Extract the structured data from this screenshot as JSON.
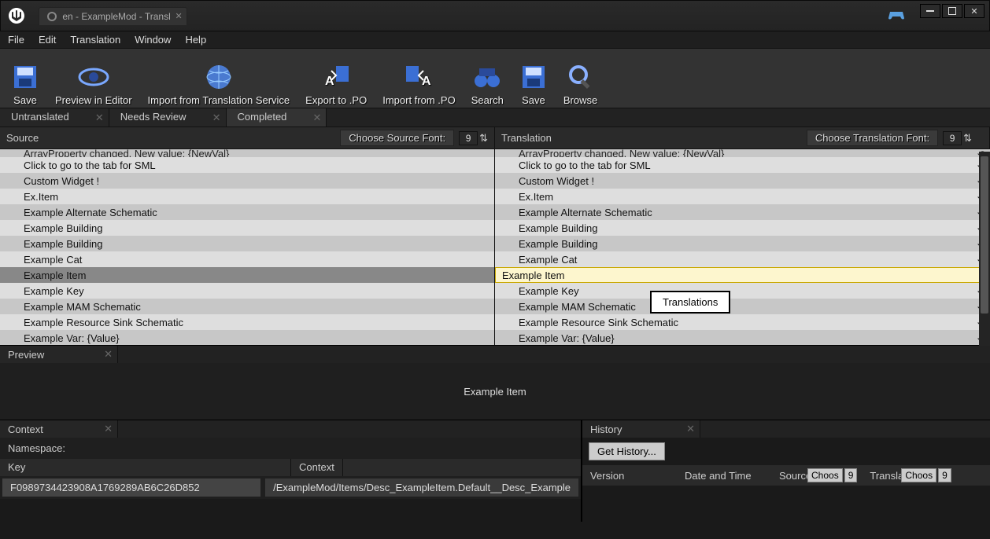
{
  "window": {
    "tab_title": "en - ExampleMod - Transl"
  },
  "menu": {
    "file": "File",
    "edit": "Edit",
    "translation": "Translation",
    "window": "Window",
    "help": "Help"
  },
  "toolbar": {
    "save": "Save",
    "preview": "Preview in Editor",
    "import_service": "Import from Translation Service",
    "export_po": "Export to .PO",
    "import_po": "Import from .PO",
    "search": "Search",
    "save2": "Save",
    "browse": "Browse"
  },
  "filter_tabs": {
    "untranslated": "Untranslated",
    "needs_review": "Needs Review",
    "completed": "Completed"
  },
  "columns": {
    "source": "Source",
    "translation": "Translation",
    "source_font_btn": "Choose Source Font:",
    "translation_font_btn": "Choose Translation Font:",
    "source_font_size": "9",
    "translation_font_size": "9"
  },
  "rows": [
    {
      "src": "Click to go to the tab for SML",
      "tr": "Click to go to the tab for SML"
    },
    {
      "src": "Custom Widget !",
      "tr": "Custom Widget !"
    },
    {
      "src": "Ex.Item",
      "tr": "Ex.Item"
    },
    {
      "src": "Example Alternate Schematic",
      "tr": "Example Alternate Schematic"
    },
    {
      "src": "Example Building",
      "tr": "Example Building"
    },
    {
      "src": "Example Building",
      "tr": "Example Building"
    },
    {
      "src": "Example Cat",
      "tr": "Example Cat"
    },
    {
      "src": "Example Item",
      "tr": "Example Item"
    },
    {
      "src": "Example Key",
      "tr": "Example Key"
    },
    {
      "src": "Example MAM Schematic",
      "tr": "Example MAM Schematic"
    },
    {
      "src": "Example Resource Sink Schematic",
      "tr": "Example Resource Sink Schematic"
    },
    {
      "src": "Example Var: {Value}",
      "tr": "Example Var: {Value}"
    }
  ],
  "row_cut": "ArrayProperty changed. New value: {NewVal}",
  "tooltip": "Translations",
  "preview": {
    "tab": "Preview",
    "value": "Example Item"
  },
  "context": {
    "tab": "Context",
    "namespace_label": "Namespace:",
    "key_header": "Key",
    "context_header": "Context",
    "key": "F0989734423908A1769289AB6C26D852",
    "path": "/ExampleMod/Items/Desc_ExampleItem.Default__Desc_Example"
  },
  "history": {
    "tab": "History",
    "get": "Get History...",
    "version": "Version",
    "datetime": "Date and Time",
    "source": "Source",
    "translation": "Transla",
    "choose": "Choos",
    "size": "9"
  }
}
